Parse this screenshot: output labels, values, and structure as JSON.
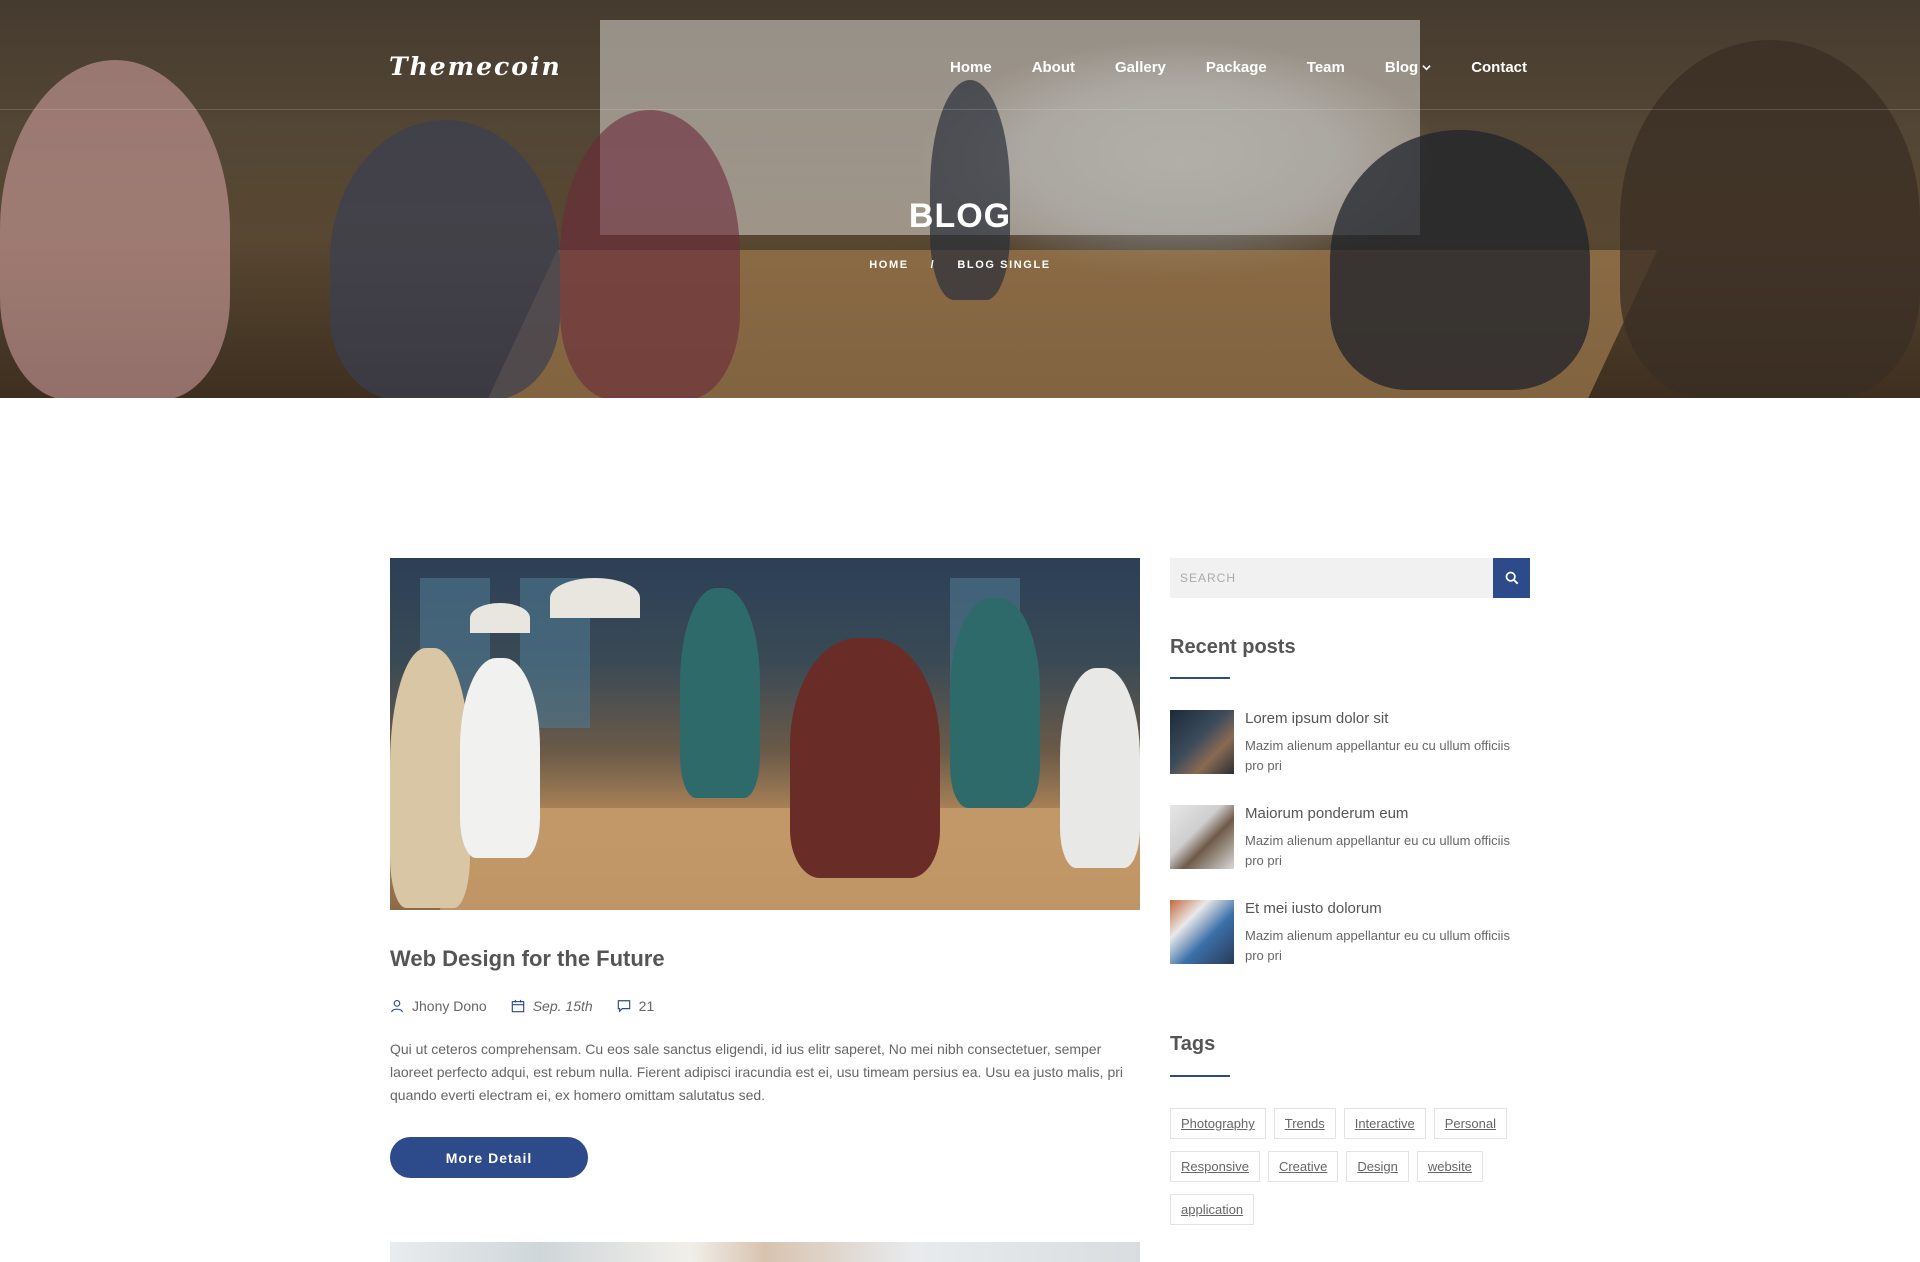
{
  "brand": {
    "logo": "Themecoin"
  },
  "nav": {
    "items": [
      {
        "label": "Home"
      },
      {
        "label": "About"
      },
      {
        "label": "Gallery"
      },
      {
        "label": "Package"
      },
      {
        "label": "Team"
      },
      {
        "label": "Blog",
        "has_dropdown": true
      },
      {
        "label": "Contact"
      }
    ]
  },
  "hero": {
    "title": "BLOG",
    "breadcrumb": {
      "home": "HOME",
      "separator": "/",
      "current": "BLOG SINGLE"
    }
  },
  "post": {
    "title": "Web Design for the Future",
    "author": "Jhony Dono",
    "date": "Sep. 15th",
    "comments": "21",
    "excerpt": "Qui ut ceteros comprehensam. Cu eos sale sanctus eligendi, id ius elitr saperet, No mei nibh consectetuer, semper laoreet perfecto adqui, est rebum nulla. Fierent adipisci iracundia est ei, usu timeam persius ea. Usu ea justo malis, pri quando everti electram ei, ex homero omittam salutatus sed.",
    "button": "More Detail"
  },
  "sidebar": {
    "search": {
      "placeholder": "SEARCH"
    },
    "recent_title": "Recent posts",
    "recent": [
      {
        "title": "Lorem ipsum dolor sit",
        "desc": "Mazim alienum appellantur eu cu ullum officiis pro pri"
      },
      {
        "title": "Maiorum ponderum eum",
        "desc": "Mazim alienum appellantur eu cu ullum officiis pro pri"
      },
      {
        "title": "Et mei iusto dolorum",
        "desc": "Mazim alienum appellantur eu cu ullum officiis pro pri"
      }
    ],
    "tags_title": "Tags",
    "tags": [
      "Photography",
      "Trends",
      "Interactive",
      "Personal",
      "Responsive",
      "Creative",
      "Design",
      "website",
      "application"
    ]
  },
  "colors": {
    "accent": "#2d4a8a",
    "text": "#555555",
    "tag_border": "#e3e3e3"
  }
}
